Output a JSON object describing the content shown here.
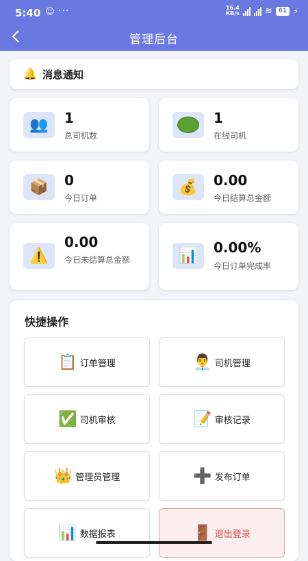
{
  "status_bar": {
    "time": "5:40",
    "speed_value": "16.4",
    "speed_unit": "KB/s",
    "battery": "61"
  },
  "nav": {
    "title": "管理后台",
    "back_icon": "chevron-left"
  },
  "notice": {
    "label": "消息通知",
    "icon": "bell"
  },
  "stats": [
    {
      "value": "1",
      "label": "总司机数",
      "icon": "users"
    },
    {
      "value": "1",
      "label": "在线司机",
      "icon": "green-oval"
    },
    {
      "value": "0",
      "label": "今日订单",
      "icon": "package"
    },
    {
      "value": "0.00",
      "label": "今日结算总金额",
      "icon": "money-bag"
    },
    {
      "value": "0.00",
      "label": "今日未结算总金额",
      "icon": "warning"
    },
    {
      "value": "0.00%",
      "label": "今日订单完成率",
      "icon": "bar-chart"
    }
  ],
  "quick_actions": {
    "title": "快捷操作",
    "items": [
      {
        "label": "订单管理",
        "icon": "clipboard"
      },
      {
        "label": "司机管理",
        "icon": "man-office-worker"
      },
      {
        "label": "司机审核",
        "icon": "check-mark"
      },
      {
        "label": "审核记录",
        "icon": "memo"
      },
      {
        "label": "管理员管理",
        "icon": "crown"
      },
      {
        "label": "发布订单",
        "icon": "plus"
      },
      {
        "label": "数据报表",
        "icon": "bar-chart"
      },
      {
        "label": "退出登录",
        "icon": "door"
      }
    ]
  },
  "colors": {
    "primary": "#6a78e2",
    "background": "#f3f4f7",
    "logout_text": "#e04848",
    "logout_bg": "#fbeeee"
  }
}
